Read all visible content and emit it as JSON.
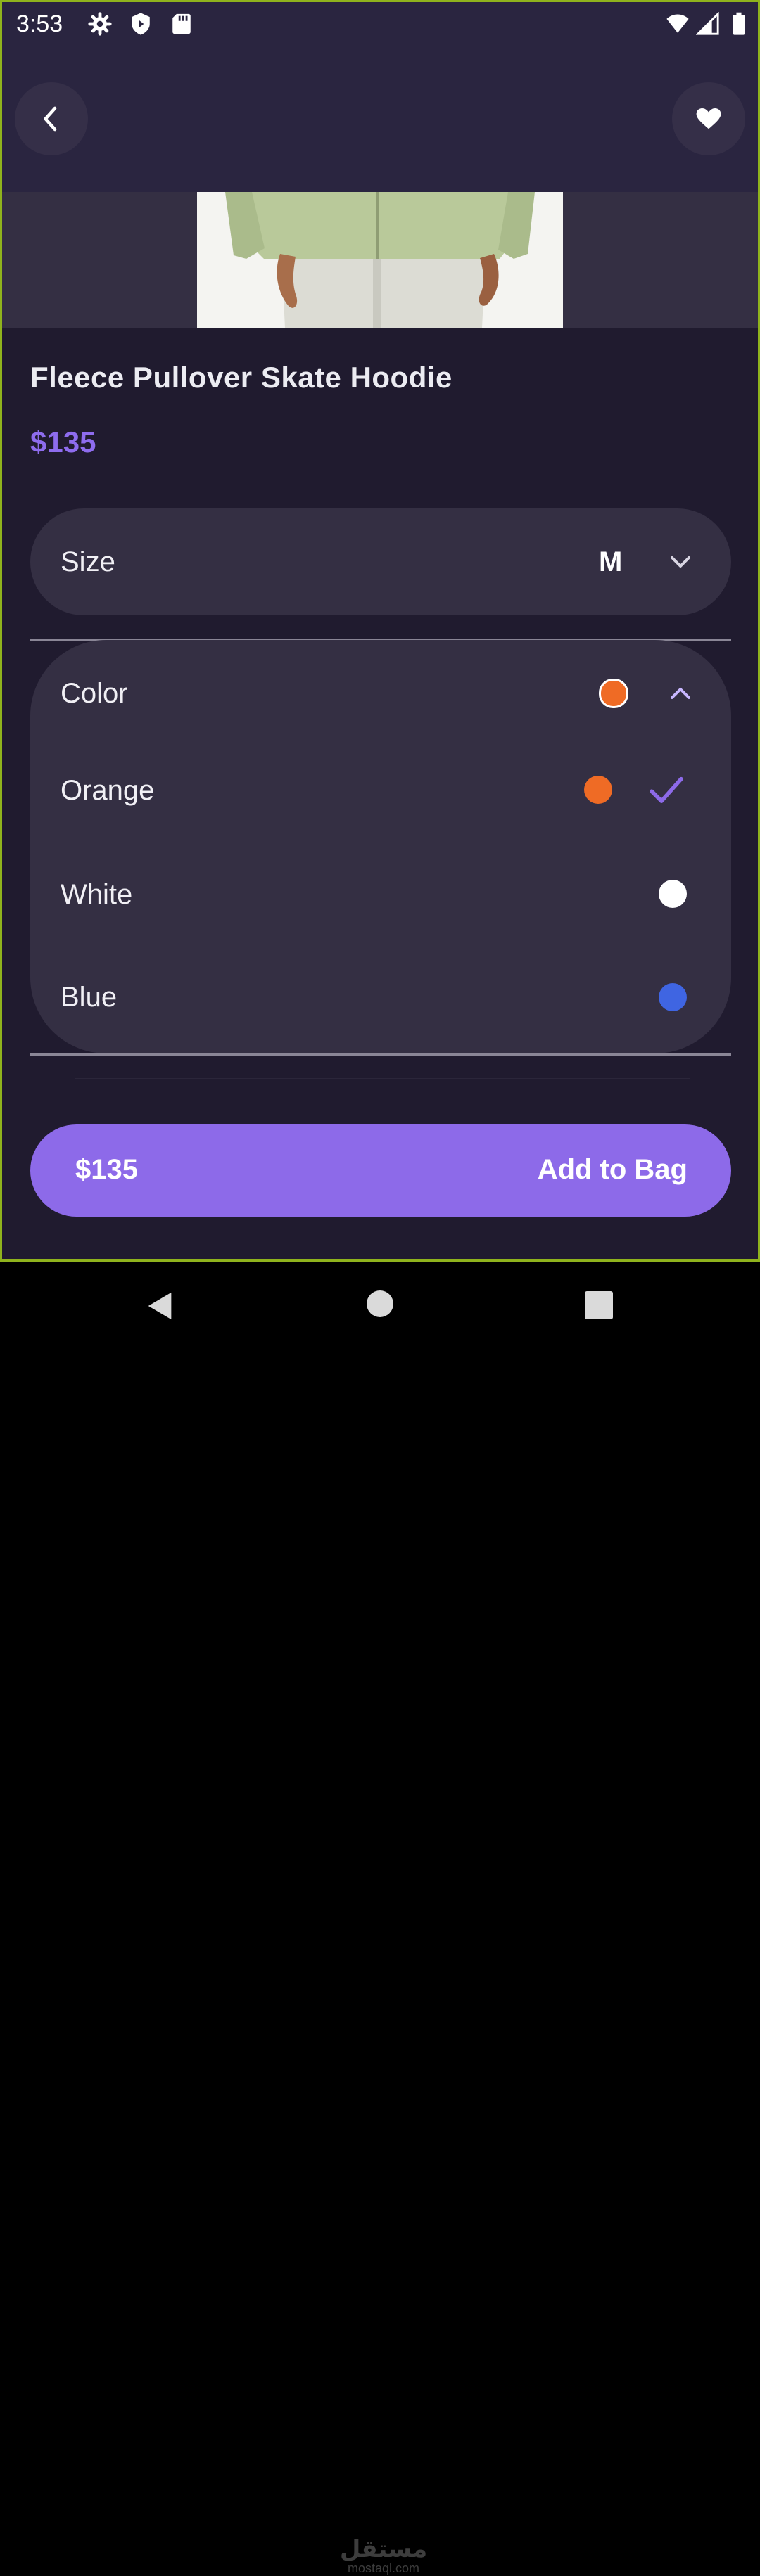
{
  "status_bar": {
    "time": "3:53",
    "icons": [
      "settings-icon",
      "shield-icon",
      "sd-card-icon",
      "wifi-icon",
      "signal-icon",
      "battery-icon"
    ]
  },
  "header": {
    "back_icon": "chevron-left-icon",
    "favorite_icon": "heart-icon"
  },
  "product": {
    "title": "Fleece Pullover Skate Hoodie",
    "price": "$135"
  },
  "size": {
    "label": "Size",
    "value": "M",
    "icon": "chevron-down-icon"
  },
  "color": {
    "label": "Color",
    "selected_color": "#ef6b25",
    "icon": "chevron-up-icon",
    "options": [
      {
        "name": "Orange",
        "hex": "#ef6b25",
        "selected": true
      },
      {
        "name": "White",
        "hex": "#ffffff",
        "selected": false
      },
      {
        "name": "Blue",
        "hex": "#3f65e2",
        "selected": false
      }
    ]
  },
  "add_to_bag": {
    "price": "$135",
    "label": "Add to Bag"
  },
  "watermark": {
    "arabic": "مستقل",
    "latin": "mostaql.com"
  },
  "theme": {
    "accent": "#8d6ae9",
    "background": "#201b2f",
    "card": "#342f43"
  }
}
